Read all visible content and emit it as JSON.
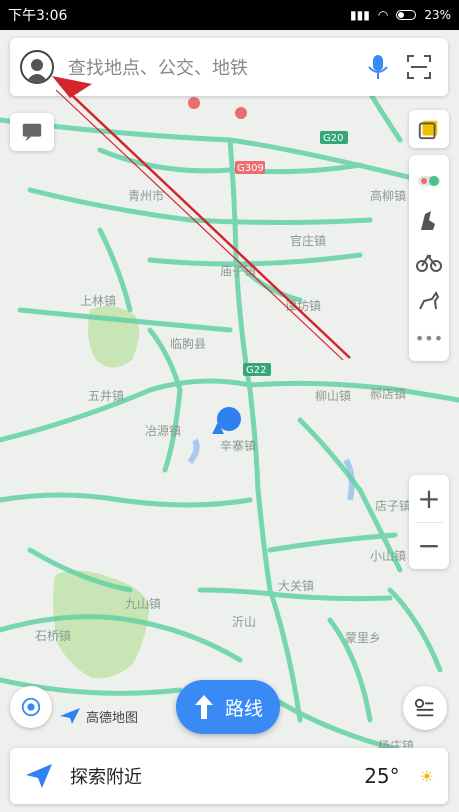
{
  "status_bar": {
    "time": "下午3:06",
    "battery": "23%"
  },
  "search": {
    "placeholder": "查找地点、公交、地铁"
  },
  "map": {
    "labels": [
      {
        "id": "qingzhou",
        "text": "青州市"
      },
      {
        "id": "miaozi",
        "text": "庙子镇"
      },
      {
        "id": "linqu",
        "text": "临朐县"
      },
      {
        "id": "yehu",
        "text": "冶源镇"
      },
      {
        "id": "xinzhai",
        "text": "辛寨镇"
      },
      {
        "id": "liushan",
        "text": "柳山镇"
      },
      {
        "id": "jiushan",
        "text": "九山镇"
      },
      {
        "id": "yishan",
        "text": "沂山"
      },
      {
        "id": "dashan",
        "text": "大关镇"
      },
      {
        "id": "xiaoshan",
        "text": "小山镇"
      },
      {
        "id": "dianzi",
        "text": "店子镇"
      },
      {
        "id": "wujing",
        "text": "五井镇"
      },
      {
        "id": "shangzhuang",
        "text": "上林镇"
      },
      {
        "id": "guanzhuang",
        "text": "官庄镇"
      },
      {
        "id": "haodian",
        "text": "郝店镇"
      },
      {
        "id": "gaoling",
        "text": "高柳镇"
      },
      {
        "id": "tanfang",
        "text": "谭坊镇"
      },
      {
        "id": "mengzi",
        "text": "蒙里乡"
      },
      {
        "id": "yangzhuang",
        "text": "杨庄镇"
      },
      {
        "id": "shiyuan",
        "text": "石桥镇"
      },
      {
        "id": "g20",
        "text": "G20"
      },
      {
        "id": "g22",
        "text": "G22"
      },
      {
        "id": "s309",
        "text": "G309"
      }
    ]
  },
  "buttons": {
    "route": "路线",
    "explore": "探索附近"
  },
  "branding": {
    "amap": "高德地图"
  },
  "weather": {
    "temperature": "25°"
  },
  "colors": {
    "road": "#63d2a5",
    "route_button": "#3a8af5",
    "arrow": "#d3252b"
  }
}
